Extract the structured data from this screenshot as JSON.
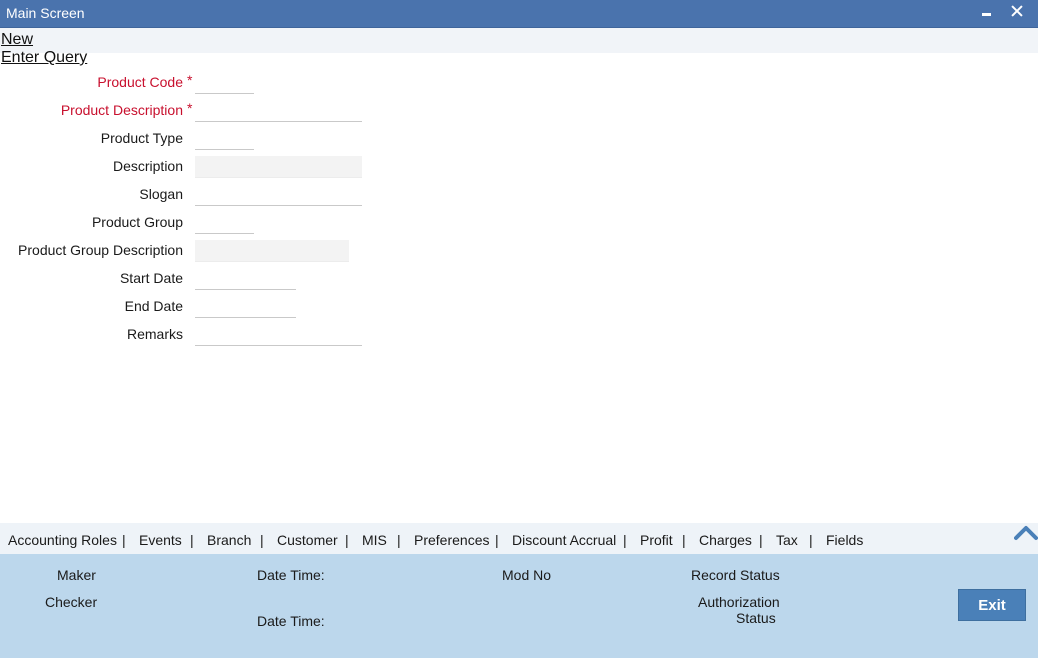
{
  "window": {
    "title": "Main Screen"
  },
  "toolbar": {
    "new_label": "New",
    "enter_query_label": "Enter Query"
  },
  "form": {
    "product_code": {
      "label": "Product Code",
      "required": "*",
      "value": ""
    },
    "product_description": {
      "label": "Product Description",
      "required": "*",
      "value": ""
    },
    "product_type": {
      "label": "Product Type",
      "value": ""
    },
    "description": {
      "label": "Description",
      "value": ""
    },
    "slogan": {
      "label": "Slogan",
      "value": ""
    },
    "product_group": {
      "label": "Product Group",
      "value": ""
    },
    "product_group_description": {
      "label": "Product Group Description",
      "value": ""
    },
    "start_date": {
      "label": "Start Date",
      "value": ""
    },
    "end_date": {
      "label": "End Date",
      "value": ""
    },
    "remarks": {
      "label": "Remarks",
      "value": ""
    }
  },
  "tabs": [
    {
      "label": "Accounting Roles"
    },
    {
      "label": "Events"
    },
    {
      "label": "Branch"
    },
    {
      "label": "Customer"
    },
    {
      "label": "MIS"
    },
    {
      "label": "Preferences"
    },
    {
      "label": "Discount Accrual"
    },
    {
      "label": "Profit"
    },
    {
      "label": "Charges"
    },
    {
      "label": "Tax"
    },
    {
      "label": "Fields"
    }
  ],
  "tab_separator": "|",
  "footer": {
    "maker": "Maker",
    "checker": "Checker",
    "date_time_1": "Date Time:",
    "date_time_2": "Date Time:",
    "mod_no": "Mod No",
    "record_status": "Record Status",
    "authorization": "Authorization",
    "status": "Status",
    "exit_label": "Exit"
  },
  "icons": {
    "minimize": "minimize-icon",
    "close": "close-icon",
    "collapse": "chevron-up-icon"
  },
  "colors": {
    "titlebar": "#4a73ad",
    "required": "#c8102e",
    "footer": "#bcd7ec",
    "button": "#4a80b8"
  }
}
